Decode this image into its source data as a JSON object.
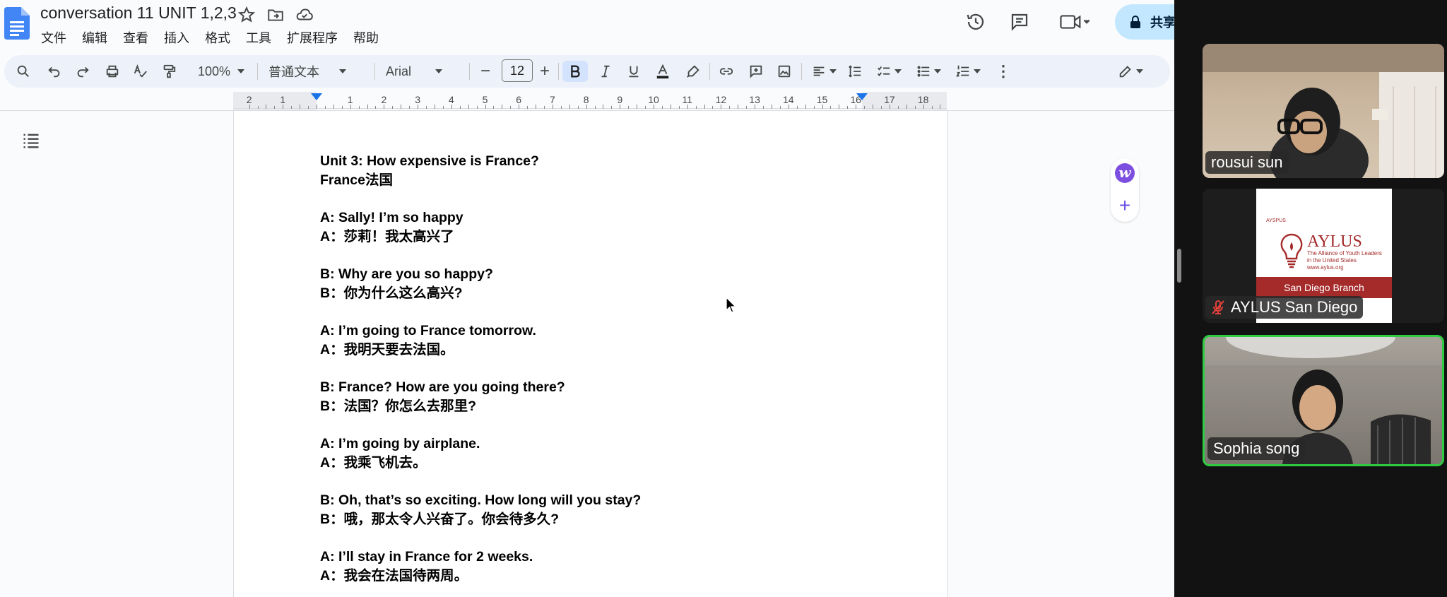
{
  "docs": {
    "title": "conversation 11 UNIT 1,2,3",
    "menu": [
      "文件",
      "编辑",
      "查看",
      "插入",
      "格式",
      "工具",
      "扩展程序",
      "帮助"
    ],
    "share_label": "共享",
    "toolbar": {
      "zoom": "100%",
      "style": "普通文本",
      "font": "Arial",
      "font_size": "12"
    },
    "ruler_numbers": [
      "2",
      "1",
      "1",
      "2",
      "3",
      "4",
      "5",
      "6",
      "7",
      "8",
      "9",
      "10",
      "11",
      "12",
      "13",
      "14",
      "15",
      "16",
      "17",
      "18"
    ],
    "content": [
      [
        "Unit 3: How expensive is France?",
        "France法国"
      ],
      [
        "A: Sally! I’m so happy",
        "A：莎莉！我太高兴了"
      ],
      [
        "B: Why are you so happy?",
        "B：你为什么这么高兴?"
      ],
      [
        "A: I’m going to France tomorrow.",
        "A：我明天要去法国。"
      ],
      [
        "B: France? How are you going there?",
        "B：法国？你怎么去那里?"
      ],
      [
        "A: I’m going by airplane.",
        "A：我乘飞机去。"
      ],
      [
        "B: Oh, that’s so exciting. How long will you stay?",
        "B：哦，那太令人兴奋了。你会待多久?"
      ],
      [
        "A: I’ll stay in France for 2 weeks.",
        "A：我会在法国待两周。"
      ]
    ]
  },
  "zoom_panel": {
    "participants": [
      {
        "name": "rousui sun",
        "muted": false,
        "active_speaker": false
      },
      {
        "name": "AYLUS San Diego",
        "muted": true,
        "active_speaker": false
      },
      {
        "name": "Sophia song",
        "muted": false,
        "active_speaker": true
      }
    ],
    "aylus_card": {
      "small_logo_text": "AYSPUS",
      "title": "AYLUS",
      "tagline": "The Alliance of Youth Leaders in the United States",
      "url": "www.aylus.org",
      "band": "San Diego Branch"
    }
  }
}
